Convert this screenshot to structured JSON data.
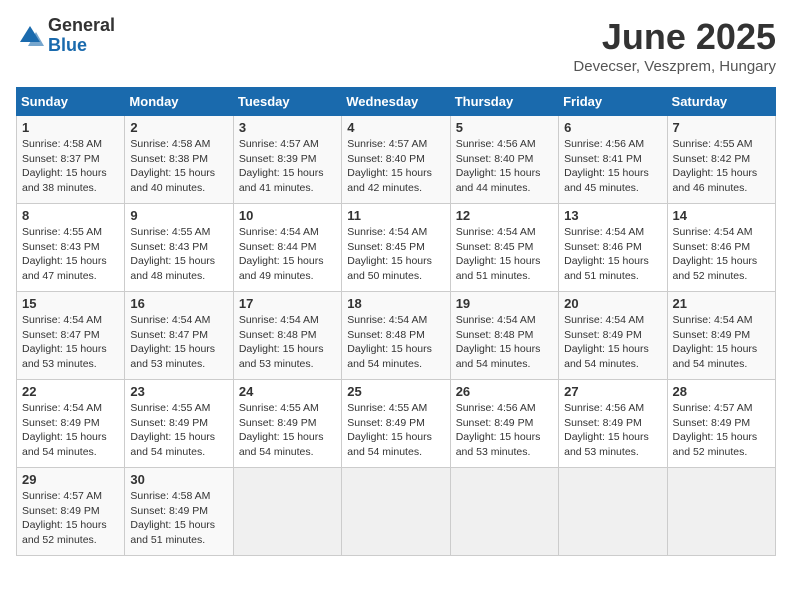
{
  "logo": {
    "general": "General",
    "blue": "Blue"
  },
  "title": "June 2025",
  "subtitle": "Devecser, Veszprem, Hungary",
  "days_header": [
    "Sunday",
    "Monday",
    "Tuesday",
    "Wednesday",
    "Thursday",
    "Friday",
    "Saturday"
  ],
  "weeks": [
    [
      {
        "day": "1",
        "sunrise": "4:58 AM",
        "sunset": "8:37 PM",
        "daylight": "15 hours and 38 minutes."
      },
      {
        "day": "2",
        "sunrise": "4:58 AM",
        "sunset": "8:38 PM",
        "daylight": "15 hours and 40 minutes."
      },
      {
        "day": "3",
        "sunrise": "4:57 AM",
        "sunset": "8:39 PM",
        "daylight": "15 hours and 41 minutes."
      },
      {
        "day": "4",
        "sunrise": "4:57 AM",
        "sunset": "8:40 PM",
        "daylight": "15 hours and 42 minutes."
      },
      {
        "day": "5",
        "sunrise": "4:56 AM",
        "sunset": "8:40 PM",
        "daylight": "15 hours and 44 minutes."
      },
      {
        "day": "6",
        "sunrise": "4:56 AM",
        "sunset": "8:41 PM",
        "daylight": "15 hours and 45 minutes."
      },
      {
        "day": "7",
        "sunrise": "4:55 AM",
        "sunset": "8:42 PM",
        "daylight": "15 hours and 46 minutes."
      }
    ],
    [
      {
        "day": "8",
        "sunrise": "4:55 AM",
        "sunset": "8:43 PM",
        "daylight": "15 hours and 47 minutes."
      },
      {
        "day": "9",
        "sunrise": "4:55 AM",
        "sunset": "8:43 PM",
        "daylight": "15 hours and 48 minutes."
      },
      {
        "day": "10",
        "sunrise": "4:54 AM",
        "sunset": "8:44 PM",
        "daylight": "15 hours and 49 minutes."
      },
      {
        "day": "11",
        "sunrise": "4:54 AM",
        "sunset": "8:45 PM",
        "daylight": "15 hours and 50 minutes."
      },
      {
        "day": "12",
        "sunrise": "4:54 AM",
        "sunset": "8:45 PM",
        "daylight": "15 hours and 51 minutes."
      },
      {
        "day": "13",
        "sunrise": "4:54 AM",
        "sunset": "8:46 PM",
        "daylight": "15 hours and 51 minutes."
      },
      {
        "day": "14",
        "sunrise": "4:54 AM",
        "sunset": "8:46 PM",
        "daylight": "15 hours and 52 minutes."
      }
    ],
    [
      {
        "day": "15",
        "sunrise": "4:54 AM",
        "sunset": "8:47 PM",
        "daylight": "15 hours and 53 minutes."
      },
      {
        "day": "16",
        "sunrise": "4:54 AM",
        "sunset": "8:47 PM",
        "daylight": "15 hours and 53 minutes."
      },
      {
        "day": "17",
        "sunrise": "4:54 AM",
        "sunset": "8:48 PM",
        "daylight": "15 hours and 53 minutes."
      },
      {
        "day": "18",
        "sunrise": "4:54 AM",
        "sunset": "8:48 PM",
        "daylight": "15 hours and 54 minutes."
      },
      {
        "day": "19",
        "sunrise": "4:54 AM",
        "sunset": "8:48 PM",
        "daylight": "15 hours and 54 minutes."
      },
      {
        "day": "20",
        "sunrise": "4:54 AM",
        "sunset": "8:49 PM",
        "daylight": "15 hours and 54 minutes."
      },
      {
        "day": "21",
        "sunrise": "4:54 AM",
        "sunset": "8:49 PM",
        "daylight": "15 hours and 54 minutes."
      }
    ],
    [
      {
        "day": "22",
        "sunrise": "4:54 AM",
        "sunset": "8:49 PM",
        "daylight": "15 hours and 54 minutes."
      },
      {
        "day": "23",
        "sunrise": "4:55 AM",
        "sunset": "8:49 PM",
        "daylight": "15 hours and 54 minutes."
      },
      {
        "day": "24",
        "sunrise": "4:55 AM",
        "sunset": "8:49 PM",
        "daylight": "15 hours and 54 minutes."
      },
      {
        "day": "25",
        "sunrise": "4:55 AM",
        "sunset": "8:49 PM",
        "daylight": "15 hours and 54 minutes."
      },
      {
        "day": "26",
        "sunrise": "4:56 AM",
        "sunset": "8:49 PM",
        "daylight": "15 hours and 53 minutes."
      },
      {
        "day": "27",
        "sunrise": "4:56 AM",
        "sunset": "8:49 PM",
        "daylight": "15 hours and 53 minutes."
      },
      {
        "day": "28",
        "sunrise": "4:57 AM",
        "sunset": "8:49 PM",
        "daylight": "15 hours and 52 minutes."
      }
    ],
    [
      {
        "day": "29",
        "sunrise": "4:57 AM",
        "sunset": "8:49 PM",
        "daylight": "15 hours and 52 minutes."
      },
      {
        "day": "30",
        "sunrise": "4:58 AM",
        "sunset": "8:49 PM",
        "daylight": "15 hours and 51 minutes."
      },
      null,
      null,
      null,
      null,
      null
    ]
  ]
}
